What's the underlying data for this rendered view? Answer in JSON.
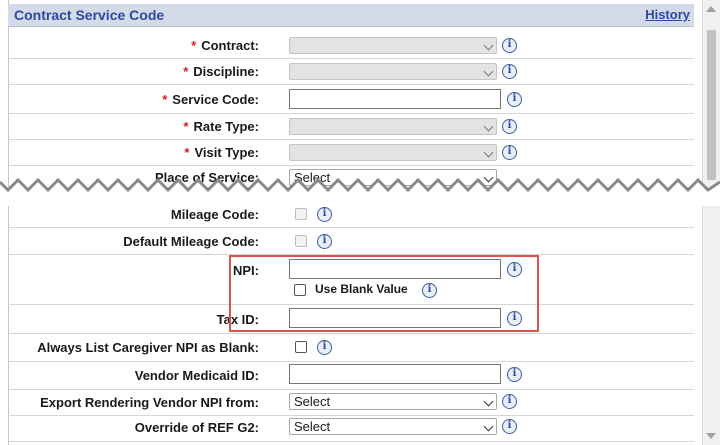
{
  "header": {
    "title": "Contract Service Code",
    "history_link": "History"
  },
  "fields": {
    "contract": {
      "label": "Contract:",
      "required": "*"
    },
    "discipline": {
      "label": "Discipline:",
      "required": "*"
    },
    "service_code": {
      "label": "Service Code:",
      "required": "*"
    },
    "rate_type": {
      "label": "Rate Type:",
      "required": "*"
    },
    "visit_type": {
      "label": "Visit Type:",
      "required": "*"
    },
    "place_of_service": {
      "label": "Place of Service:",
      "value": "Select"
    },
    "mileage_code": {
      "label": "Mileage Code:"
    },
    "default_mileage_code": {
      "label": "Default Mileage Code:"
    },
    "npi": {
      "label": "NPI:",
      "use_blank_label": "Use Blank Value"
    },
    "tax_id": {
      "label": "Tax ID:"
    },
    "always_list_caregiver_npi_blank": {
      "label": "Always List Caregiver NPI as Blank:"
    },
    "vendor_medicaid_id": {
      "label": "Vendor Medicaid ID:"
    },
    "export_rendering_vendor_npi": {
      "label": "Export Rendering Vendor NPI from:",
      "value": "Select"
    },
    "override_ref_g2": {
      "label": "Override of REF G2:",
      "value": "Select"
    }
  },
  "info_icon_glyph": "i",
  "colors": {
    "accent": "#2b4aa0",
    "required": "#d32020",
    "highlight_box": "#d9534f",
    "header_bg": "#d5dae8"
  }
}
